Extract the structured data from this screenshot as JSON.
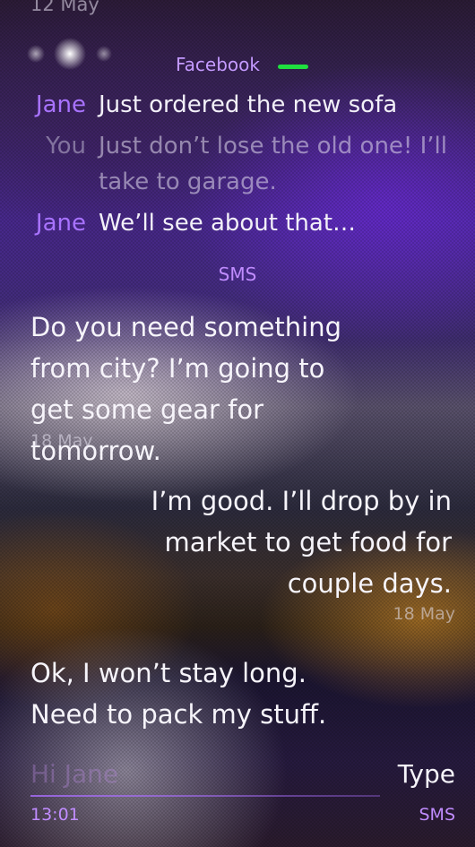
{
  "thread": {
    "top_date": "12 May",
    "facebook_section": {
      "source_label": "Facebook",
      "presence_color": "#1fe03f",
      "messages": [
        {
          "sender": "Jane",
          "text": "Just ordered the new sofa"
        },
        {
          "sender": "You",
          "text": "Just don’t lose the old one! I’ll take to garage."
        },
        {
          "sender": "Jane",
          "text": "We’ll see about that…"
        }
      ]
    },
    "sms_section": {
      "source_label": "SMS",
      "messages": [
        {
          "direction": "incoming",
          "text": "Do you need something from city? I’m going to get some gear for tomorrow.",
          "timestamp": "18 May"
        },
        {
          "direction": "outgoing",
          "text": "I’m good. I’ll drop by in market to get food for couple days.",
          "timestamp": "18 May"
        },
        {
          "direction": "incoming",
          "text": "Ok, I won’t stay long. Need to pack my stuff.",
          "timestamp": ""
        }
      ]
    }
  },
  "composer": {
    "placeholder": "Hi Jane",
    "send_label": "Type",
    "time": "13:01",
    "channel": "SMS"
  },
  "colors": {
    "accent": "#a873ff",
    "highlight": "#c08cff"
  }
}
